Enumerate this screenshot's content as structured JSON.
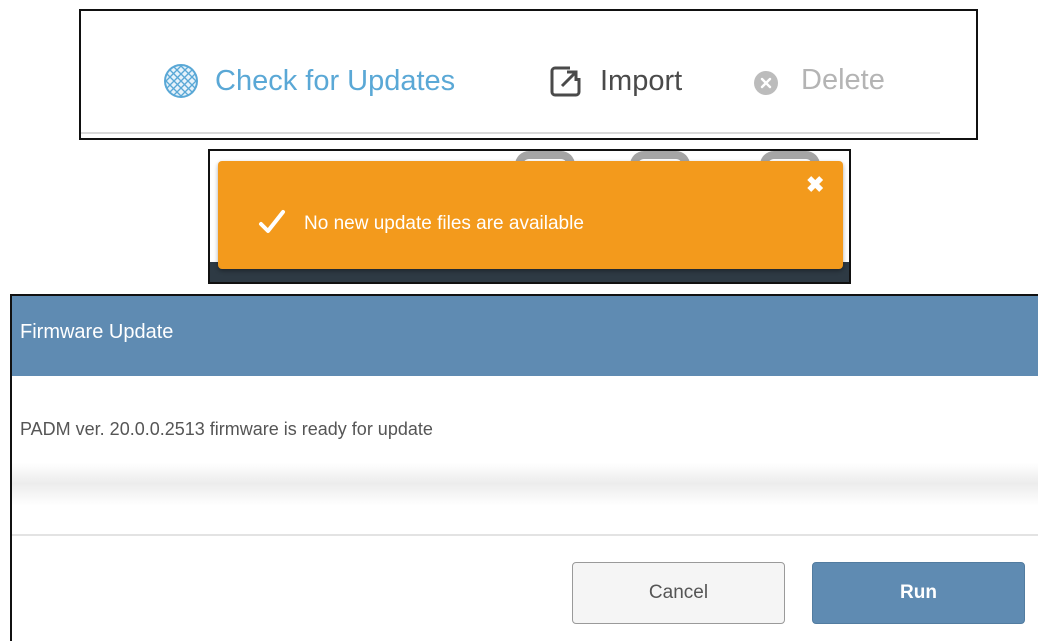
{
  "toolbar": {
    "check_label": "Check for Updates",
    "import_label": "Import",
    "delete_label": "Delete",
    "icons": {
      "check": "globe-icon",
      "import": "import-icon",
      "delete": "close-circle-icon"
    },
    "colors": {
      "check": "#5aa8d6",
      "import": "#4a4a4a",
      "delete": "#b4b4b4"
    }
  },
  "toast": {
    "message": "No new update files are available",
    "close_symbol": "✖",
    "background": "#f39a1c",
    "icons": {
      "status": "checkmark-icon",
      "close": "close-icon"
    }
  },
  "dialog": {
    "title": "Firmware Update",
    "message": "PADM ver. 20.0.0.2513 firmware is ready for update",
    "cancel_label": "Cancel",
    "run_label": "Run",
    "header_color": "#5f8bb2"
  }
}
